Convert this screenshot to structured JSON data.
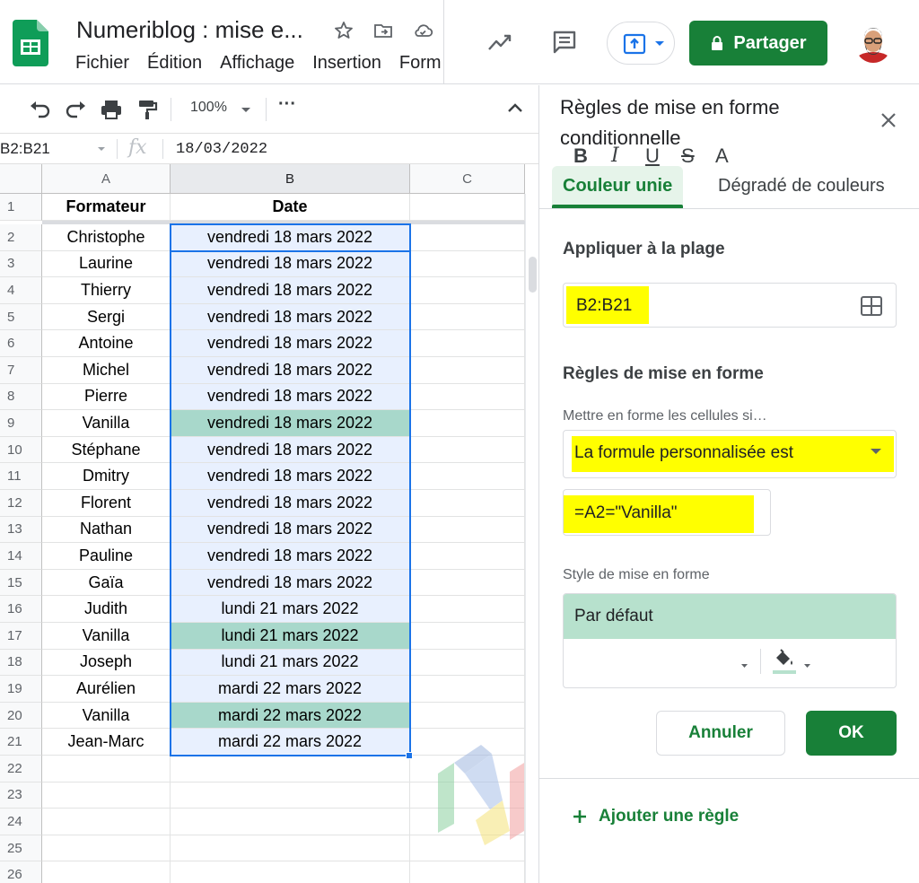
{
  "app": {
    "title": "Numeriblog : mise e...",
    "menu": [
      "Fichier",
      "Édition",
      "Affichage",
      "Insertion",
      "Form"
    ],
    "share_label": "Partager"
  },
  "toolbar": {
    "zoom": "100%",
    "more": "···"
  },
  "formula_bar": {
    "name_box": "B2:B21",
    "fx_label": "fx",
    "value": "18/03/2022"
  },
  "sheet": {
    "columns": [
      "A",
      "B",
      "C"
    ],
    "header_row": {
      "num": "1",
      "a": "Formateur",
      "b": "Date"
    },
    "rows": [
      {
        "num": "2",
        "a": "Christophe",
        "b": "vendredi 18 mars 2022",
        "hl": false
      },
      {
        "num": "3",
        "a": "Laurine",
        "b": "vendredi 18 mars 2022",
        "hl": false
      },
      {
        "num": "4",
        "a": "Thierry",
        "b": "vendredi 18 mars 2022",
        "hl": false
      },
      {
        "num": "5",
        "a": "Sergi",
        "b": "vendredi 18 mars 2022",
        "hl": false
      },
      {
        "num": "6",
        "a": "Antoine",
        "b": "vendredi 18 mars 2022",
        "hl": false
      },
      {
        "num": "7",
        "a": "Michel",
        "b": "vendredi 18 mars 2022",
        "hl": false
      },
      {
        "num": "8",
        "a": "Pierre",
        "b": "vendredi 18 mars 2022",
        "hl": false
      },
      {
        "num": "9",
        "a": "Vanilla",
        "b": "vendredi 18 mars 2022",
        "hl": true
      },
      {
        "num": "10",
        "a": "Stéphane",
        "b": "vendredi 18 mars 2022",
        "hl": false
      },
      {
        "num": "11",
        "a": "Dmitry",
        "b": "vendredi 18 mars 2022",
        "hl": false
      },
      {
        "num": "12",
        "a": "Florent",
        "b": "vendredi 18 mars 2022",
        "hl": false
      },
      {
        "num": "13",
        "a": "Nathan",
        "b": "vendredi 18 mars 2022",
        "hl": false
      },
      {
        "num": "14",
        "a": "Pauline",
        "b": "vendredi 18 mars 2022",
        "hl": false
      },
      {
        "num": "15",
        "a": "Gaïa",
        "b": "vendredi 18 mars 2022",
        "hl": false
      },
      {
        "num": "16",
        "a": "Judith",
        "b": "lundi 21 mars 2022",
        "hl": false
      },
      {
        "num": "17",
        "a": "Vanilla",
        "b": "lundi 21 mars 2022",
        "hl": true
      },
      {
        "num": "18",
        "a": "Joseph",
        "b": "lundi 21 mars 2022",
        "hl": false
      },
      {
        "num": "19",
        "a": "Aurélien",
        "b": "mardi 22 mars 2022",
        "hl": false
      },
      {
        "num": "20",
        "a": "Vanilla",
        "b": "mardi 22 mars 2022",
        "hl": true
      },
      {
        "num": "21",
        "a": "Jean-Marc",
        "b": "mardi 22 mars 2022",
        "hl": false
      }
    ],
    "empty_rows": [
      "22",
      "23",
      "24",
      "25",
      "26"
    ]
  },
  "panel": {
    "title": "Règles de mise en forme conditionnelle",
    "tab_active": "Couleur unie",
    "tab_inactive": "Dégradé de couleurs",
    "apply_range_label": "Appliquer à la plage",
    "apply_range_value": "B2:B21",
    "rules_label": "Règles de mise en forme",
    "condition_label": "Mettre en forme les cellules si…",
    "condition_value": "La formule personnalisée est",
    "formula_value": "=A2=\"Vanilla\"",
    "style_label": "Style de mise en forme",
    "style_preview": "Par défaut",
    "style_tools": {
      "bold": "B",
      "italic": "I",
      "underline": "U",
      "strike": "S",
      "text_color": "A"
    },
    "cancel_label": "Annuler",
    "ok_label": "OK",
    "add_rule_label": "Ajouter une règle"
  },
  "colors": {
    "accent_green": "#188038",
    "highlight_fill": "#a8d8cb",
    "selection_fill": "#e8f0fe",
    "selection_border": "#1a73e8",
    "marker_yellow": "#ffff00",
    "style_preview_bg": "#b7e1cd"
  }
}
